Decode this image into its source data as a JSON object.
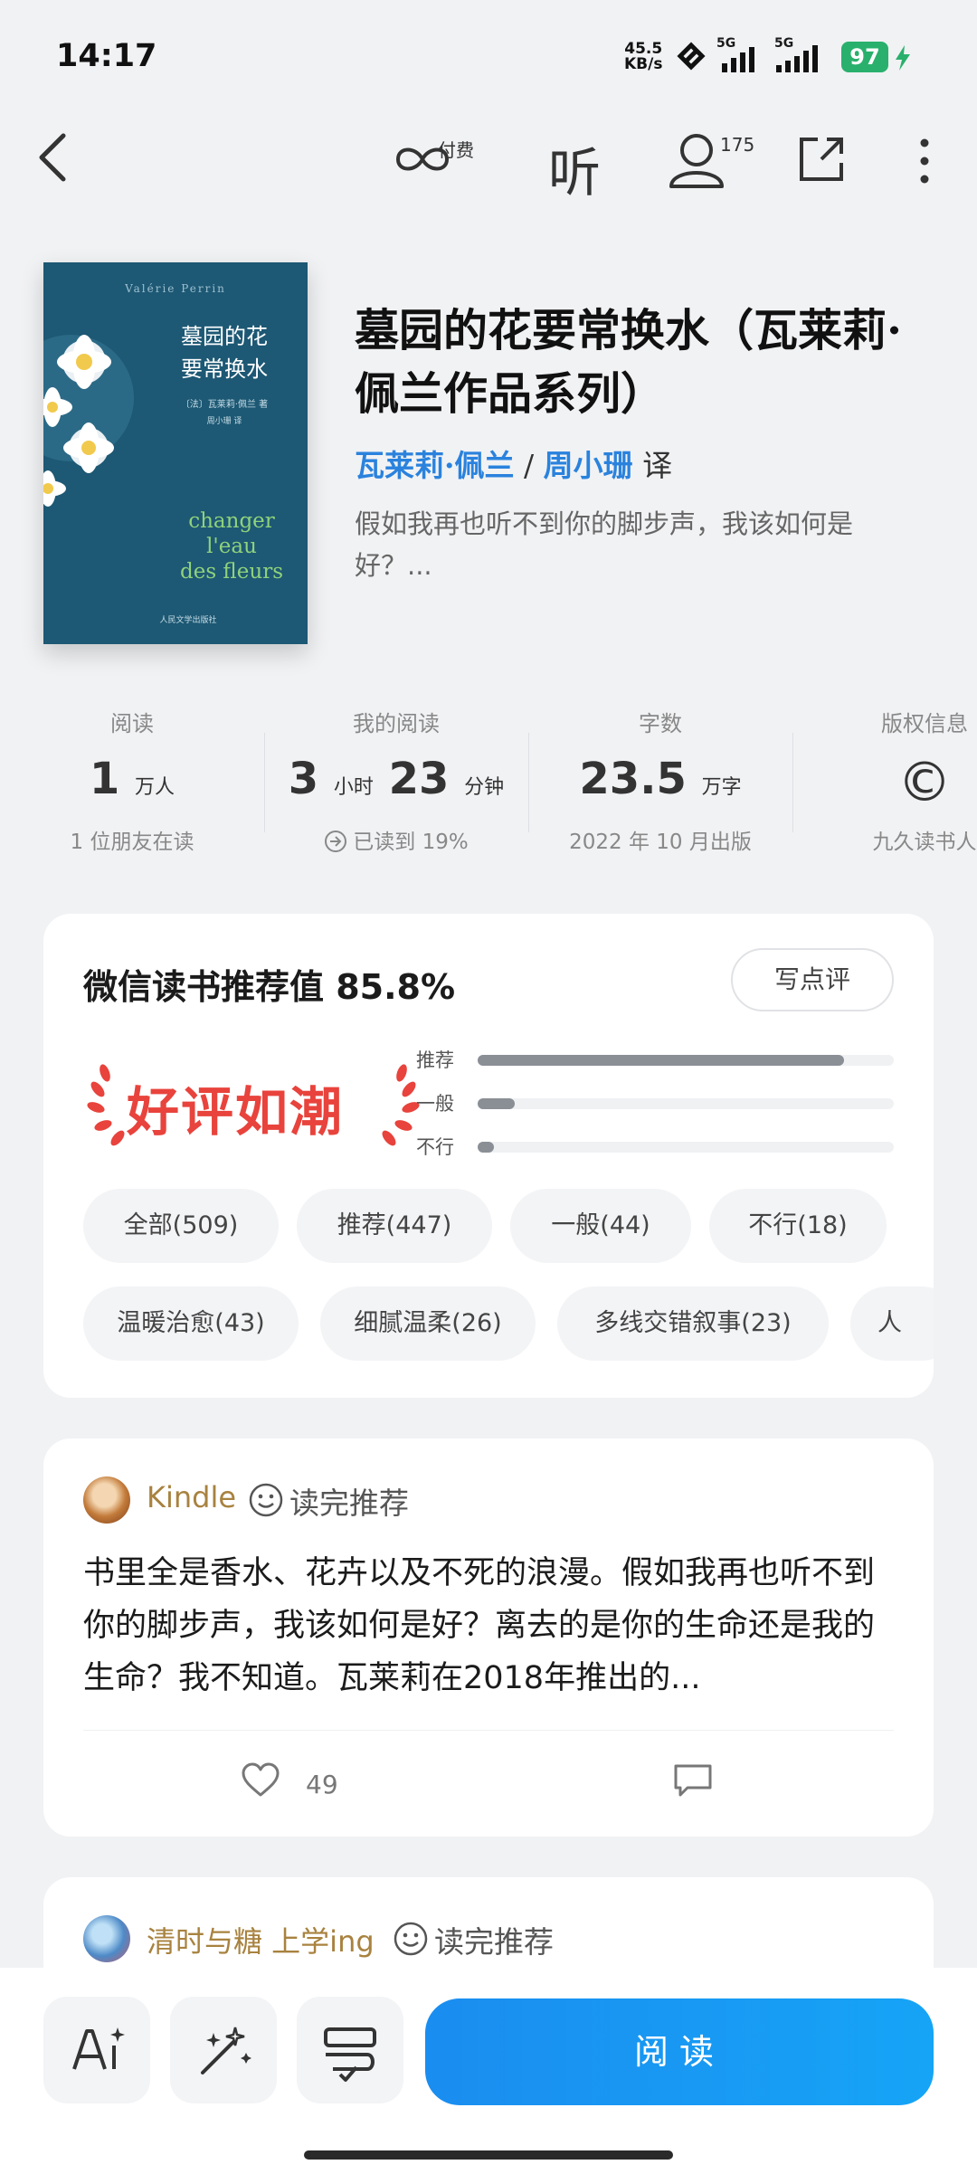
{
  "status_bar": {
    "time": "14:17",
    "net_speed_value": "45.5",
    "net_speed_unit": "KB/s",
    "signal_1": "5G",
    "signal_2": "5G",
    "battery": "97"
  },
  "top_nav": {
    "paid_label": "付费",
    "listen_label": "听",
    "readers_count": "175"
  },
  "book": {
    "cover": {
      "top_line": "Valérie Perrin",
      "title_line1": "墓园的花",
      "title_line2": "要常换水",
      "author": "〔法〕瓦莱莉·佩兰 著",
      "translator": "周小珊 译",
      "french_title_1": "changer",
      "french_title_2": "l'eau",
      "french_title_3": "des fleurs",
      "publisher": "人民文学出版社"
    },
    "title": "墓园的花要常换水（瓦莱莉·佩兰作品系列）",
    "author": "瓦莱莉·佩兰",
    "separator": "/",
    "translator": "周小珊",
    "translator_suffix": "译",
    "blurb": "假如我再也听不到你的脚步声，我该如何是好？..."
  },
  "stats": [
    {
      "label": "阅读",
      "value": "1",
      "unit": "万人",
      "sub": "1 位朋友在读"
    },
    {
      "label": "我的阅读",
      "value_a": "3",
      "unit_a": "小时",
      "value_b": "23",
      "unit_b": "分钟",
      "sub": "已读到 19%"
    },
    {
      "label": "字数",
      "value": "23.5",
      "unit": "万字",
      "sub": "2022 年 10 月出版"
    },
    {
      "label": "版权信息",
      "value": "©",
      "sub": "九久读书人"
    }
  ],
  "rating": {
    "title": "微信读书推荐值 85.8%",
    "write_review": "写点评",
    "badge": "好评如潮",
    "bars": [
      {
        "label": "推荐",
        "fraction": 0.88
      },
      {
        "label": "一般",
        "fraction": 0.09
      },
      {
        "label": "不行",
        "fraction": 0.04
      }
    ],
    "filters": [
      "全部(509)",
      "推荐(447)",
      "一般(44)",
      "不行(18)"
    ],
    "tags": [
      "温暖治愈(43)",
      "细腻温柔(26)",
      "多线交错叙事(23)",
      "人"
    ]
  },
  "reviews": [
    {
      "user": "Kindle",
      "tag": "读完推荐",
      "text": "书里全是香水、花卉以及不死的浪漫。假如我再也听不到你的脚步声，我该如何是好？离去的是你的生命还是我的生命？我不知道。瓦莱莉在2018年推出的...",
      "likes": "49"
    },
    {
      "user": "清时与糖 上学ing",
      "tag": "读完推荐"
    }
  ],
  "bottom_bar": {
    "read_label": "阅读"
  },
  "colors": {
    "accent_blue": "#1a8df0",
    "link_blue": "#2a82dd",
    "badge_red": "#e8433c",
    "reviewer_gold": "#a8823f",
    "battery_green": "#29b06d"
  }
}
